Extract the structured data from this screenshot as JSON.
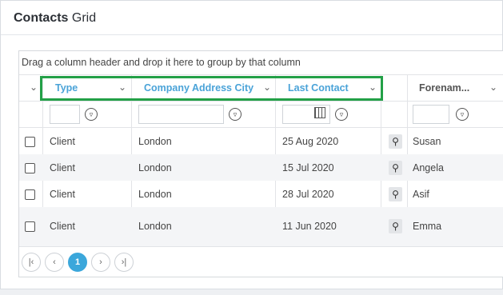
{
  "panel": {
    "title_bold": "Contacts",
    "title_rest": " Grid"
  },
  "grid": {
    "group_hint": "Drag a column header and drop it here to group by that column",
    "columns": [
      {
        "label": "Type"
      },
      {
        "label": "Company Address City"
      },
      {
        "label": "Last Contact"
      },
      {
        "label": "Forenam..."
      }
    ],
    "rows": [
      {
        "type": "Client",
        "city": "London",
        "last_contact": "25 Aug 2020",
        "forename": "Susan"
      },
      {
        "type": "Client",
        "city": "London",
        "last_contact": "15 Jul 2020",
        "forename": "Angela"
      },
      {
        "type": "Client",
        "city": "London",
        "last_contact": "28 Jul 2020",
        "forename": "Asif"
      },
      {
        "type": "Client",
        "city": "London",
        "last_contact": "11 Jun 2020",
        "forename": "Emma"
      }
    ],
    "pager": {
      "current_page": "1"
    }
  },
  "colors": {
    "header_link": "#4aa3d8",
    "highlight": "#23a047",
    "pager_active": "#3ba7db"
  }
}
